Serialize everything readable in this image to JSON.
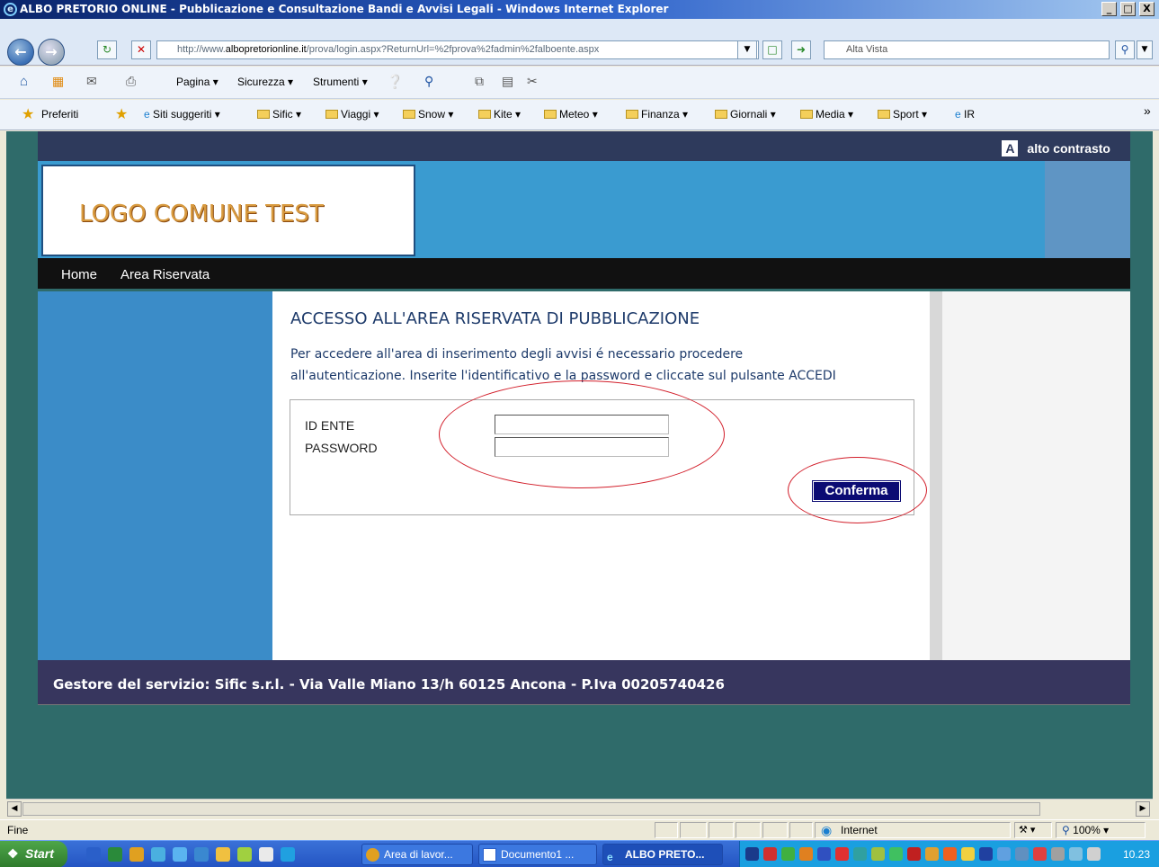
{
  "window": {
    "title": "ALBO PRETORIO ONLINE - Pubblicazione e Consultazione Bandi e Avvisi Legali - Windows Internet Explorer",
    "controls": {
      "minimize": "_",
      "maximize": "□",
      "close": "X"
    }
  },
  "address": {
    "url_prefix": "http://www.",
    "url_domain": "albopretorionline.it",
    "url_path": "/prova/login.aspx?ReturnUrl=%2fprova%2fadmin%2falboente.aspx",
    "search_placeholder": "Alta Vista"
  },
  "command_bar": {
    "items": [
      "Pagina",
      "Sicurezza",
      "Strumenti"
    ]
  },
  "favorites_bar": {
    "favorites_label": "Preferiti",
    "items": [
      "Siti suggeriti",
      "Sific",
      "Viaggi",
      "Snow",
      "Kite",
      "Meteo",
      "Finanza",
      "Giornali",
      "Media",
      "Sport",
      "IR"
    ],
    "more": "»"
  },
  "page": {
    "contrast_label": "alto contrasto",
    "logo_text": "LOGO COMUNE TEST",
    "nav": [
      "Home",
      "Area Riservata"
    ],
    "heading": "ACCESSO ALL'AREA RISERVATA DI PUBBLICAZIONE",
    "intro_line1": "Per accedere all'area di inserimento degli avvisi é necessario procedere",
    "intro_line2": "all'autenticazione. Inserite l'identificativo e la password  e cliccate sul pulsante ACCEDI",
    "form": {
      "id_label": "ID ENTE",
      "id_value": "",
      "password_label": "PASSWORD",
      "password_value": "",
      "submit_label": "Conferma"
    },
    "footer": "Gestore del servizio: Sific s.r.l. - Via Valle Miano 13/h 60125 Ancona - P.Iva 00205740426"
  },
  "status_bar": {
    "text": "Fine",
    "zone": "Internet",
    "zoom": "100%"
  },
  "taskbar": {
    "start_label": "Start",
    "tasks": [
      "Area di lavor...",
      "Documento1 ...",
      "ALBO PRETO..."
    ],
    "clock": "10.23"
  },
  "colors": {
    "annotation": "#d21e2a",
    "page_bg": "#2f6b6a",
    "banner": "#3a9bd0",
    "confirm_button": "#0b0b73"
  }
}
